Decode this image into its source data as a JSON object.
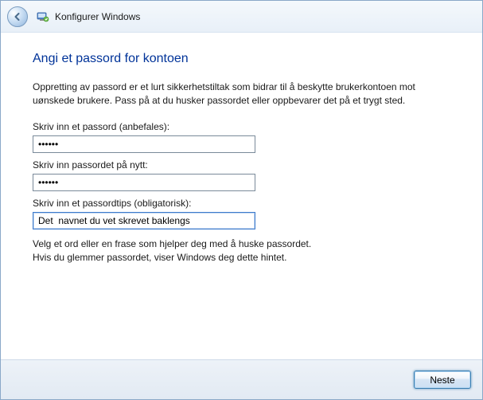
{
  "header": {
    "title": "Konfigurer Windows"
  },
  "main": {
    "heading": "Angi et passord for kontoen",
    "instruction": "Oppretting av passord er et lurt sikkerhetstiltak som bidrar til å beskytte brukerkontoen mot uønskede brukere. Pass på at du husker passordet eller oppbevarer det på et trygt sted.",
    "password_label": "Skriv inn et passord (anbefales):",
    "password_value": "••••••",
    "password_confirm_label": "Skriv inn passordet på nytt:",
    "password_confirm_value": "••••••",
    "hint_label": "Skriv inn et passordtips (obligatorisk):",
    "hint_value": "Det  navnet du vet skrevet baklengs",
    "help_line1": "Velg et ord eller en frase som hjelper deg med å huske passordet.",
    "help_line2": "Hvis du glemmer passordet, viser Windows deg dette hintet."
  },
  "footer": {
    "next_label": "Neste"
  }
}
